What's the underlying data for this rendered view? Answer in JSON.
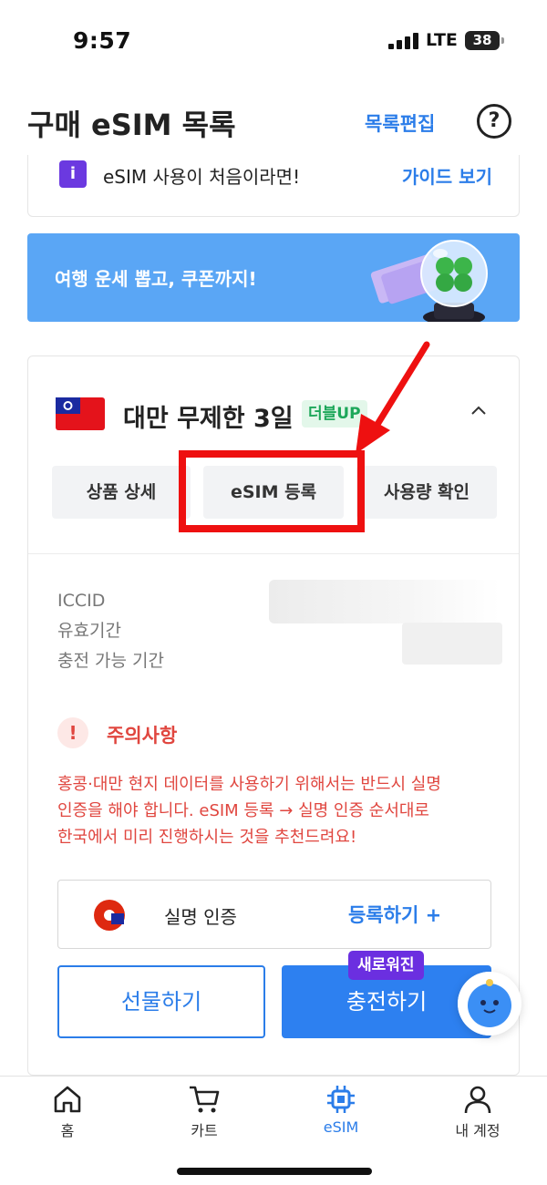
{
  "status_bar": {
    "time": "9:57",
    "network": "LTE",
    "battery": "38"
  },
  "header": {
    "title": "구매 eSIM 목록",
    "edit_label": "목록편집",
    "help_icon": "question-circle-icon"
  },
  "guide": {
    "text": "eSIM 사용이 처음이라면!",
    "link": "가이드 보기",
    "icon_letter": "i"
  },
  "banner": {
    "text": "여행 운세 뽑고, 쿠폰까지!"
  },
  "product": {
    "name": "대만 무제한 3일",
    "badge": "더블UP",
    "tabs": [
      "상품 상세",
      "eSIM 등록",
      "사용량 확인"
    ],
    "info_labels": [
      "ICCID",
      "유효기간",
      "충전 가능 기간"
    ],
    "caution_title": "주의사항",
    "caution_lines": [
      "홍콩·대만 현지 데이터를 사용하기 위해서는 반드시 실명",
      "인증을 해야 합니다. eSIM 등록 → 실명 인증 순서대로",
      "한국에서 미리 진행하시는 것을 추천드려요!"
    ],
    "verify_label": "실명 인증",
    "verify_action": "등록하기 +",
    "gift_button": "선물하기",
    "charge_button": "충전하기",
    "new_badge": "새로워진"
  },
  "bottom_nav": [
    {
      "label": "홈",
      "icon": "home-icon"
    },
    {
      "label": "카트",
      "icon": "cart-icon"
    },
    {
      "label": "eSIM",
      "icon": "esim-chip-icon"
    },
    {
      "label": "내 계정",
      "icon": "account-icon"
    }
  ],
  "colors": {
    "accent": "#2b7de9",
    "warning": "#e0463f",
    "highlight": "#ee1010",
    "badge_green": "#1da75a",
    "purple": "#6b2fe0"
  }
}
